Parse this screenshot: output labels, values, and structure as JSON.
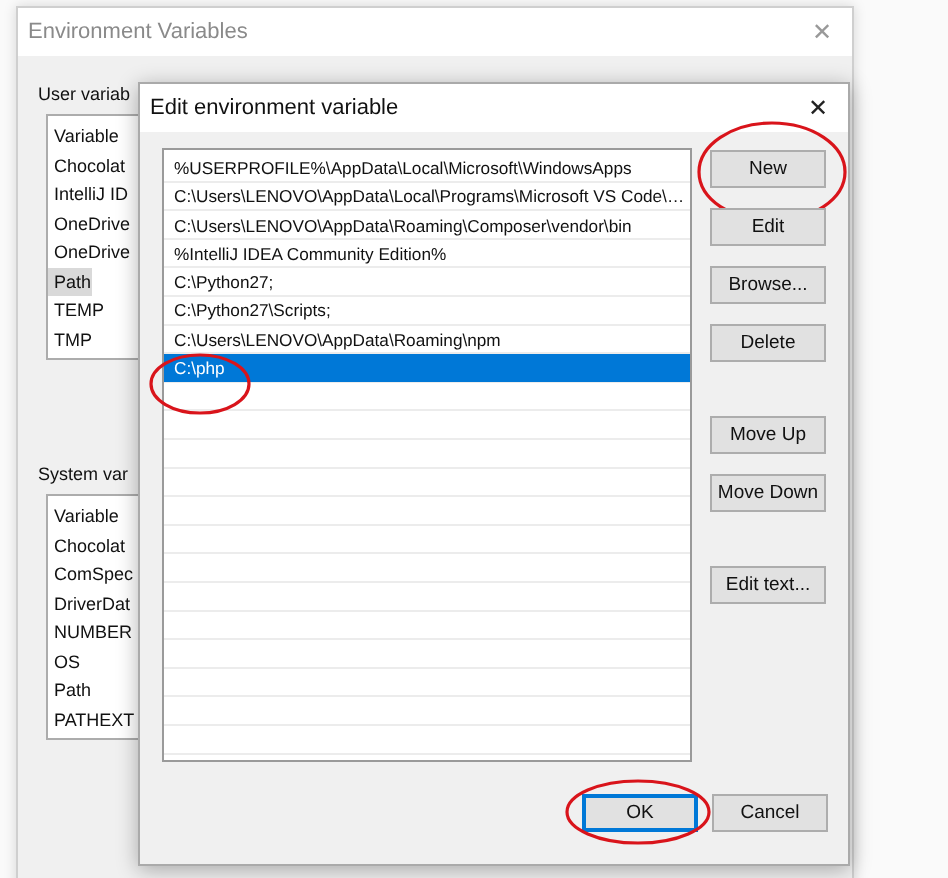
{
  "back_window": {
    "title": "Environment Variables",
    "user_section": {
      "label": "User variab",
      "items": [
        {
          "text": "Variable",
          "selected": false
        },
        {
          "text": "Chocolat",
          "selected": false
        },
        {
          "text": "IntelliJ ID",
          "selected": false
        },
        {
          "text": "OneDrive",
          "selected": false
        },
        {
          "text": "OneDrive",
          "selected": false
        },
        {
          "text": "Path",
          "selected": true
        },
        {
          "text": "TEMP",
          "selected": false
        },
        {
          "text": "TMP",
          "selected": false
        }
      ]
    },
    "system_section": {
      "label": "System var",
      "items": [
        {
          "text": "Variable",
          "selected": false
        },
        {
          "text": "Chocolat",
          "selected": false
        },
        {
          "text": "ComSpec",
          "selected": false
        },
        {
          "text": "DriverDat",
          "selected": false
        },
        {
          "text": "NUMBER",
          "selected": false
        },
        {
          "text": "OS",
          "selected": false
        },
        {
          "text": "Path",
          "selected": false
        },
        {
          "text": "PATHEXT",
          "selected": false
        }
      ]
    }
  },
  "dialog": {
    "title": "Edit environment variable",
    "close": "✕",
    "entries": [
      {
        "text": "%USERPROFILE%\\AppData\\Local\\Microsoft\\WindowsApps",
        "selected": false,
        "circled": false
      },
      {
        "text": "C:\\Users\\LENOVO\\AppData\\Local\\Programs\\Microsoft VS Code\\…",
        "selected": false,
        "circled": false
      },
      {
        "text": "C:\\Users\\LENOVO\\AppData\\Roaming\\Composer\\vendor\\bin",
        "selected": false,
        "circled": false
      },
      {
        "text": "%IntelliJ IDEA Community Edition%",
        "selected": false,
        "circled": false
      },
      {
        "text": "C:\\Python27;",
        "selected": false,
        "circled": false
      },
      {
        "text": "C:\\Python27\\Scripts;",
        "selected": false,
        "circled": false
      },
      {
        "text": "C:\\Users\\LENOVO\\AppData\\Roaming\\npm",
        "selected": false,
        "circled": false
      },
      {
        "text": "C:\\php",
        "selected": true,
        "circled": true
      }
    ],
    "button_groups": [
      [
        {
          "label": "New",
          "circled": true
        },
        {
          "label": "Edit",
          "circled": false
        },
        {
          "label": "Browse...",
          "circled": false
        },
        {
          "label": "Delete",
          "circled": false
        }
      ],
      [
        {
          "label": "Move Up",
          "circled": false
        },
        {
          "label": "Move Down",
          "circled": false
        }
      ],
      [
        {
          "label": "Edit text...",
          "circled": false
        }
      ]
    ],
    "footer_buttons": [
      {
        "label": "OK",
        "default": true,
        "circled": true
      },
      {
        "label": "Cancel",
        "default": false,
        "circled": false
      }
    ]
  },
  "back_close": "✕"
}
